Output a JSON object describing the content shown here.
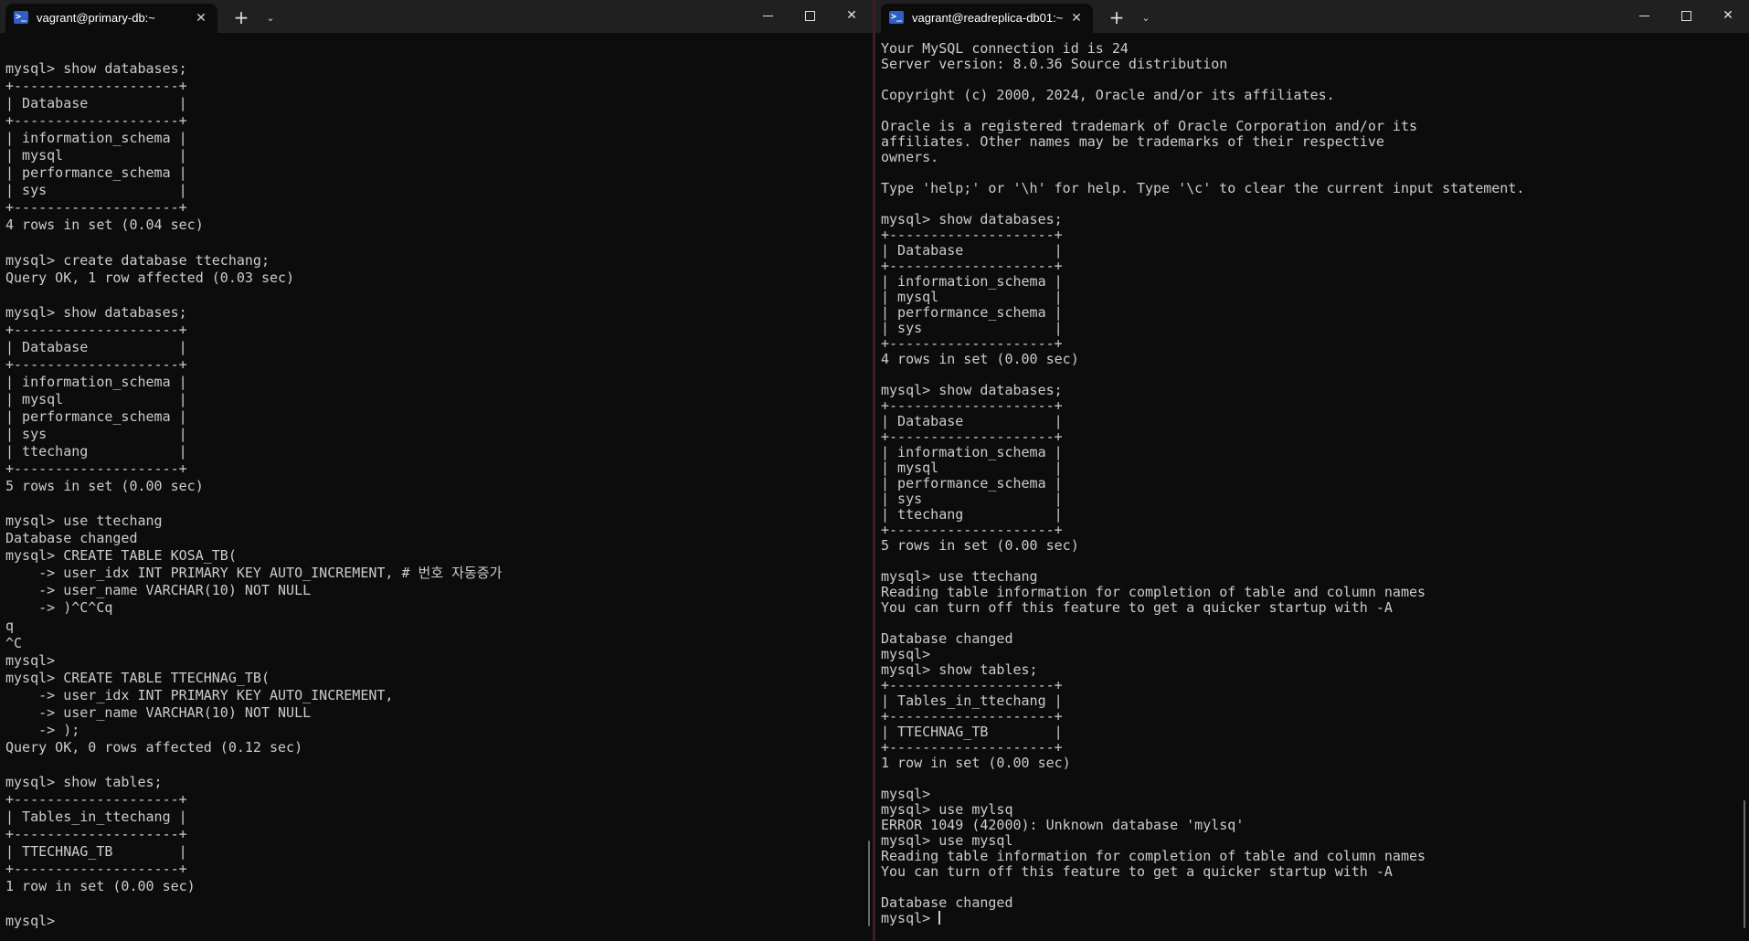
{
  "left_window": {
    "tab_title": "vagrant@primary-db:~",
    "terminal_output": "mysql> show databases;\n+--------------------+\n| Database           |\n+--------------------+\n| information_schema |\n| mysql              |\n| performance_schema |\n| sys                |\n+--------------------+\n4 rows in set (0.04 sec)\n\nmysql> create database ttechang;\nQuery OK, 1 row affected (0.03 sec)\n\nmysql> show databases;\n+--------------------+\n| Database           |\n+--------------------+\n| information_schema |\n| mysql              |\n| performance_schema |\n| sys                |\n| ttechang           |\n+--------------------+\n5 rows in set (0.00 sec)\n\nmysql> use ttechang\nDatabase changed\nmysql> CREATE TABLE KOSA_TB(\n    -> user_idx INT PRIMARY KEY AUTO_INCREMENT, # 번호 자동증가\n    -> user_name VARCHAR(10) NOT NULL\n    -> )^C^Cq\nq\n^C\nmysql>\nmysql> CREATE TABLE TTECHNAG_TB(\n    -> user_idx INT PRIMARY KEY AUTO_INCREMENT,\n    -> user_name VARCHAR(10) NOT NULL\n    -> );\nQuery OK, 0 rows affected (0.12 sec)\n\nmysql> show tables;\n+--------------------+\n| Tables_in_ttechang |\n+--------------------+\n| TTECHNAG_TB        |\n+--------------------+\n1 row in set (0.00 sec)\n\nmysql> "
  },
  "right_window": {
    "tab_title": "vagrant@readreplica-db01:~",
    "terminal_output": "Your MySQL connection id is 24\nServer version: 8.0.36 Source distribution\n\nCopyright (c) 2000, 2024, Oracle and/or its affiliates.\n\nOracle is a registered trademark of Oracle Corporation and/or its\naffiliates. Other names may be trademarks of their respective\nowners.\n\nType 'help;' or '\\h' for help. Type '\\c' to clear the current input statement.\n\nmysql> show databases;\n+--------------------+\n| Database           |\n+--------------------+\n| information_schema |\n| mysql              |\n| performance_schema |\n| sys                |\n+--------------------+\n4 rows in set (0.00 sec)\n\nmysql> show databases;\n+--------------------+\n| Database           |\n+--------------------+\n| information_schema |\n| mysql              |\n| performance_schema |\n| sys                |\n| ttechang           |\n+--------------------+\n5 rows in set (0.00 sec)\n\nmysql> use ttechang\nReading table information for completion of table and column names\nYou can turn off this feature to get a quicker startup with -A\n\nDatabase changed\nmysql>\nmysql> show tables;\n+--------------------+\n| Tables_in_ttechang |\n+--------------------+\n| TTECHNAG_TB        |\n+--------------------+\n1 row in set (0.00 sec)\n\nmysql>\nmysql> use mylsq\nERROR 1049 (42000): Unknown database 'mylsq'\nmysql> use mysql\nReading table information for completion of table and column names\nYou can turn off this feature to get a quicker startup with -A\n\nDatabase changed\nmysql> "
  },
  "icons": {
    "tab_icon": "terminal-icon",
    "tab_close_glyph": "✕",
    "new_tab_glyph": "+",
    "dropdown_glyph": "⌄",
    "close_window_glyph": "✕"
  },
  "colors": {
    "terminal_bg": "#0c0c0c",
    "terminal_fg": "#cccccc",
    "titlebar_bg": "#202020",
    "tab_icon_bg": "#2f5fc4"
  }
}
